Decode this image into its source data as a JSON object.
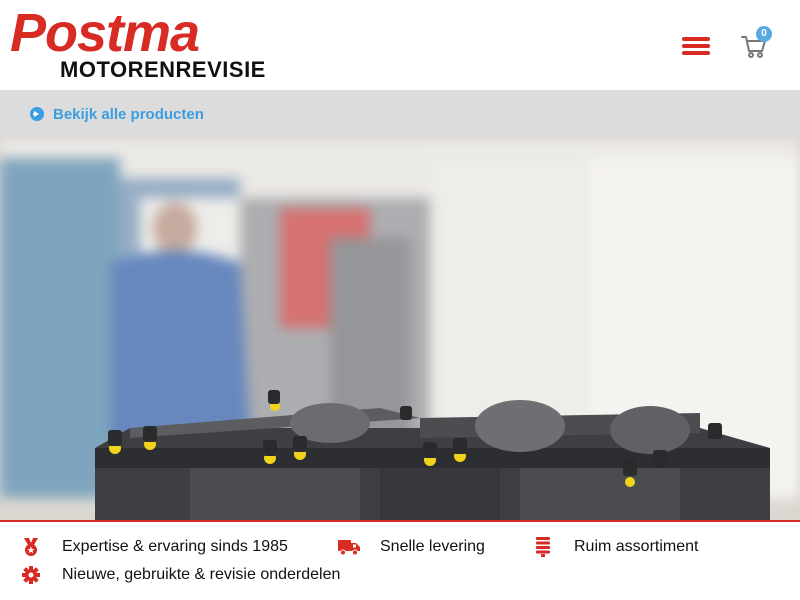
{
  "header": {
    "logo_main": "Postma",
    "logo_sub": "MOTORENREVISIE",
    "cart_count": "0"
  },
  "subbar": {
    "link_label": "Bekijk alle producten"
  },
  "features": [
    {
      "icon": "medal-icon",
      "label": "Expertise & ervaring sinds 1985"
    },
    {
      "icon": "truck-icon",
      "label": "Snelle levering"
    },
    {
      "icon": "list-icon",
      "label": "Ruim assortiment"
    },
    {
      "icon": "gear-icon",
      "label": "Nieuwe, gebruikte & revisie onderdelen"
    }
  ],
  "colors": {
    "brand_red": "#d72b24",
    "link_blue": "#3b9ee0",
    "subbar_gray": "#dcdcdc"
  }
}
